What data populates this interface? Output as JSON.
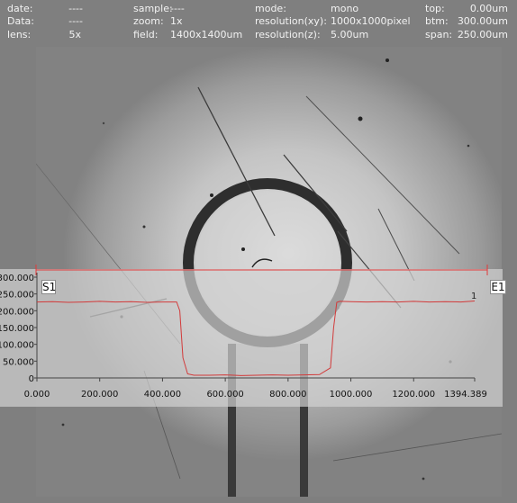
{
  "header": {
    "date_label": "date:",
    "date_value": "----",
    "data_label": "Data:",
    "data_value": "----",
    "lens_label": "lens:",
    "lens_value": "5x",
    "sample_label": "sample:",
    "sample_value": "----",
    "zoom_label": "zoom:",
    "zoom_value": "1x",
    "field_label": "field:",
    "field_value": "1400x1400um",
    "mode_label": "mode:",
    "mode_value": "mono",
    "resxy_label": "resolution(xy):",
    "resxy_value": "1000x1000pixel",
    "resz_label": "resolution(z):",
    "resz_value": "5.00um",
    "top_label": "top:",
    "top_value": "0.00um",
    "btm_label": "btm:",
    "btm_value": "300.00um",
    "span_label": "span:",
    "span_value": "250.00um"
  },
  "profile": {
    "start_marker": "S1",
    "end_marker": "E1",
    "series_label": "1"
  },
  "colors": {
    "background": "#7f7f7f",
    "header_text": "#f2f2f2",
    "line_red": "#e23a3a",
    "overlay_band": "#d2d2d2"
  },
  "chart_data": {
    "type": "line",
    "x_ticks": [
      "0.000",
      "200.000",
      "400.000",
      "600.000",
      "800.000",
      "1000.000",
      "1200.000",
      "1394.389"
    ],
    "y_ticks": [
      "300.000",
      "250.000",
      "200.000",
      "150.000",
      "100.000",
      "50.000",
      "0"
    ],
    "xlim": [
      0,
      1394.389
    ],
    "ylim": [
      0,
      300
    ],
    "series": [
      {
        "name": "1",
        "x": [
          0,
          50,
          100,
          150,
          200,
          250,
          300,
          350,
          400,
          445,
          455,
          465,
          480,
          500,
          550,
          600,
          650,
          700,
          750,
          800,
          850,
          900,
          935,
          945,
          955,
          965,
          1000,
          1050,
          1100,
          1150,
          1200,
          1250,
          1300,
          1350,
          1394.389
        ],
        "y": [
          226,
          227,
          225,
          226,
          228,
          226,
          227,
          225,
          226,
          226,
          200,
          60,
          12,
          8,
          8,
          9,
          7,
          8,
          9,
          8,
          9,
          10,
          30,
          150,
          225,
          228,
          227,
          226,
          227,
          226,
          228,
          226,
          227,
          226,
          229
        ]
      }
    ]
  }
}
